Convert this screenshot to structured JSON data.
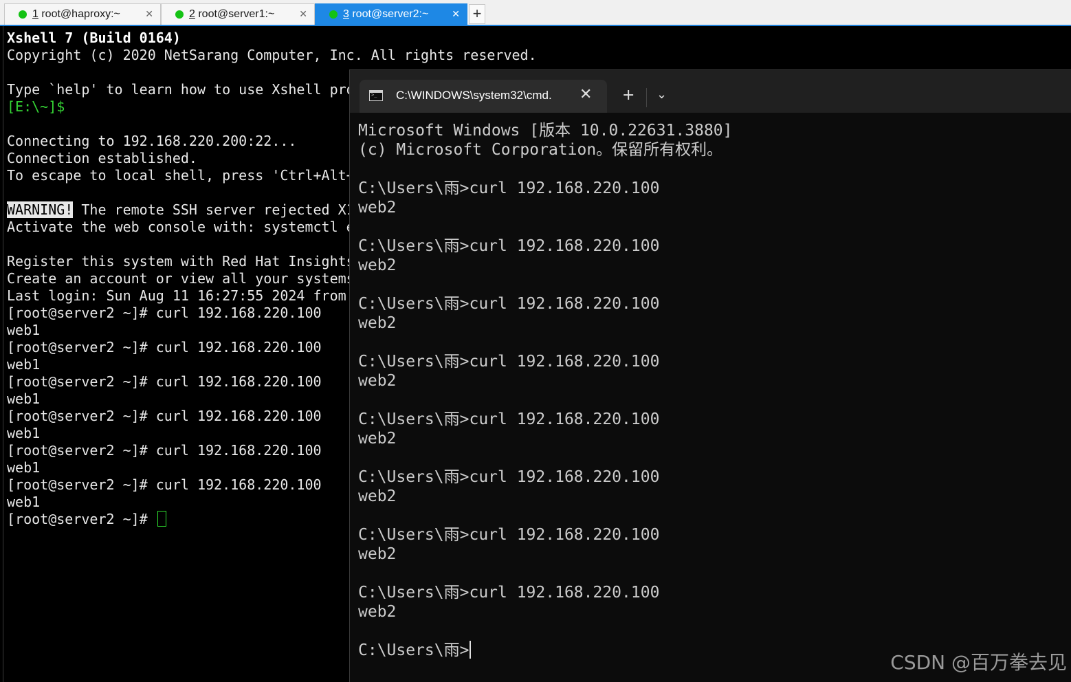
{
  "xshell": {
    "tabs": [
      {
        "num": "1",
        "title": " root@haproxy:~",
        "close": "✕",
        "status_color": "#14c214",
        "active": false
      },
      {
        "num": "2",
        "title": " root@server1:~",
        "close": "✕",
        "status_color": "#14c214",
        "active": false
      },
      {
        "num": "3",
        "title": " root@server2:~",
        "close": "✕",
        "status_color": "#14c214",
        "active": true
      }
    ],
    "new_tab_label": "+",
    "accent_color": "#1e88e5",
    "terminal": {
      "banner_title": "Xshell 7 (Build 0164)",
      "copyright": "Copyright (c) 2020 NetSarang Computer, Inc. All rights reserved.",
      "help": "Type `help' to learn how to use Xshell pro",
      "local_prompt": "[E:\\~]$",
      "connecting": "Connecting to 192.168.220.200:22...",
      "established": "Connection established.",
      "escape": "To escape to local shell, press 'Ctrl+Alt+",
      "warning_badge": "WARNING!",
      "warning_text": " The remote SSH server rejected X1",
      "activate": "Activate the web console with: systemctl e",
      "register": "Register this system with Red Hat Insights",
      "create_account": "Create an account or view all your systems",
      "last_login": "Last login: Sun Aug 11 16:27:55 2024 from",
      "session": [
        {
          "command": "[root@server2 ~]# curl 192.168.220.100",
          "output": "web1"
        },
        {
          "command": "[root@server2 ~]# curl 192.168.220.100",
          "output": "web1"
        },
        {
          "command": "[root@server2 ~]# curl 192.168.220.100",
          "output": "web1"
        },
        {
          "command": "[root@server2 ~]# curl 192.168.220.100",
          "output": "web1"
        },
        {
          "command": "[root@server2 ~]# curl 192.168.220.100",
          "output": "web1"
        },
        {
          "command": "[root@server2 ~]# curl 192.168.220.100",
          "output": "web1"
        }
      ],
      "current_prompt": "[root@server2 ~]# "
    }
  },
  "cmd_window": {
    "tab_title": "C:\\WINDOWS\\system32\\cmd.",
    "tab_close": "✕",
    "new_tab": "+",
    "dropdown": "⌄",
    "version_line": "Microsoft Windows [版本 10.0.22631.3880]",
    "copyright_line": "(c) Microsoft Corporation。保留所有权利。",
    "session": [
      {
        "command": "C:\\Users\\雨>curl 192.168.220.100",
        "output": "web2"
      },
      {
        "command": "C:\\Users\\雨>curl 192.168.220.100",
        "output": "web2"
      },
      {
        "command": "C:\\Users\\雨>curl 192.168.220.100",
        "output": "web2"
      },
      {
        "command": "C:\\Users\\雨>curl 192.168.220.100",
        "output": "web2"
      },
      {
        "command": "C:\\Users\\雨>curl 192.168.220.100",
        "output": "web2"
      },
      {
        "command": "C:\\Users\\雨>curl 192.168.220.100",
        "output": "web2"
      },
      {
        "command": "C:\\Users\\雨>curl 192.168.220.100",
        "output": "web2"
      },
      {
        "command": "C:\\Users\\雨>curl 192.168.220.100",
        "output": "web2"
      }
    ],
    "current_prompt": "C:\\Users\\雨>"
  },
  "watermark": "CSDN @百万拳去见"
}
